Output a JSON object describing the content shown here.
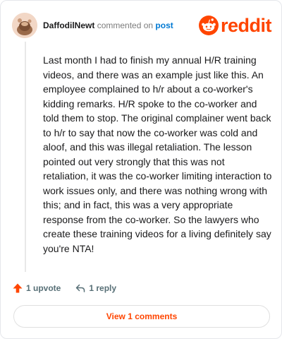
{
  "header": {
    "username": "DaffodilNewt",
    "action_text": "commented on",
    "post_link": "post",
    "logo_text": "reddit",
    "icons": {
      "avatar": "user-avatar",
      "logo": "reddit-alien-icon"
    }
  },
  "comment": {
    "body": "Last month I had to finish my annual H/R training videos, and there was an example just like this. An employee complained to h/r about a co-worker's kidding remarks. H/R spoke to the co-worker and told them to stop. The original complainer went back to h/r to say that now the co-worker was cold and aloof, and this was illegal retaliation. The lesson pointed out very strongly that this was not retaliation, it was the co-worker limiting interaction to work issues only, and there was nothing wrong with this; and in fact, this was a very appropriate response from the co-worker. So the lawyers who create these training videos for a living definitely say you're NTA!"
  },
  "actions": {
    "upvote_label": "1 upvote",
    "reply_label": "1 reply",
    "icons": {
      "upvote": "upvote-arrow-icon",
      "reply": "reply-arrow-icon"
    }
  },
  "footer": {
    "view_comments_label": "View 1 comments"
  },
  "colors": {
    "brand": "#ff4500",
    "link": "#0079d3",
    "muted": "#576f76"
  }
}
